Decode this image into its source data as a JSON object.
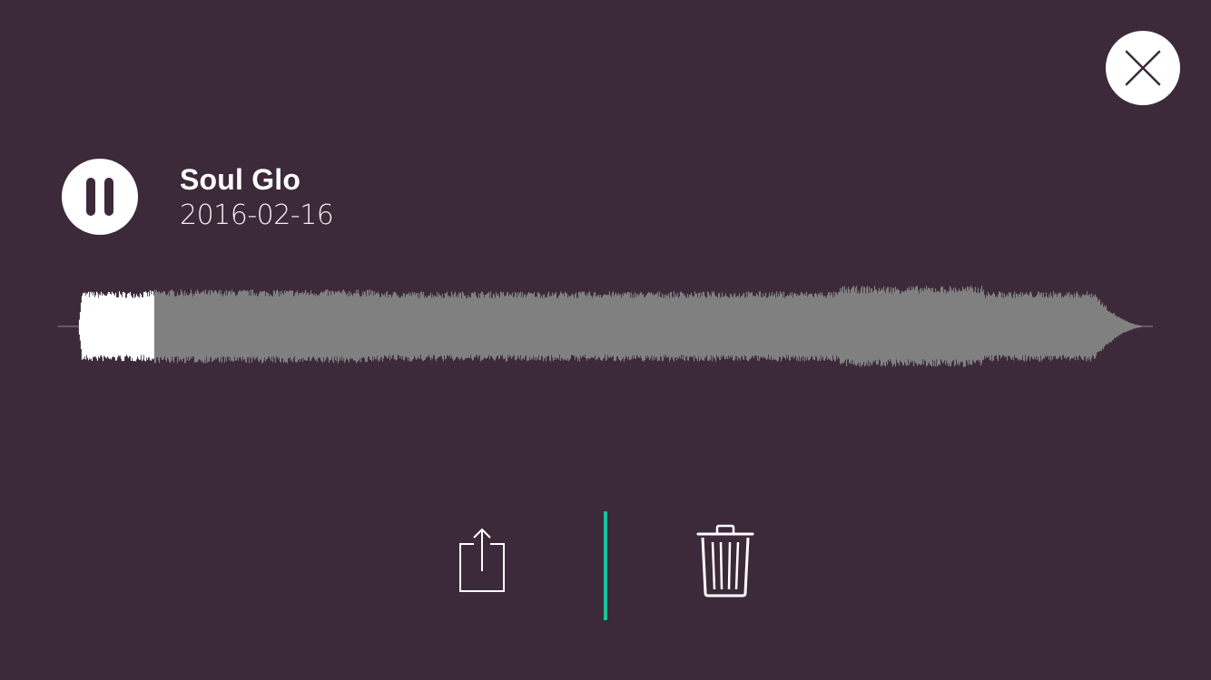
{
  "track": {
    "title": "Soul Glo",
    "date": "2016-02-16"
  },
  "player": {
    "state": "playing",
    "progress": 0.075
  },
  "icons": {
    "close": "close-icon",
    "pause": "pause-icon",
    "share": "share-icon",
    "delete": "trash-icon"
  },
  "colors": {
    "background": "#3c2a3a",
    "waveform_unplayed": "#808080",
    "waveform_played": "#ffffff",
    "accent_divider": "#19c39a"
  }
}
